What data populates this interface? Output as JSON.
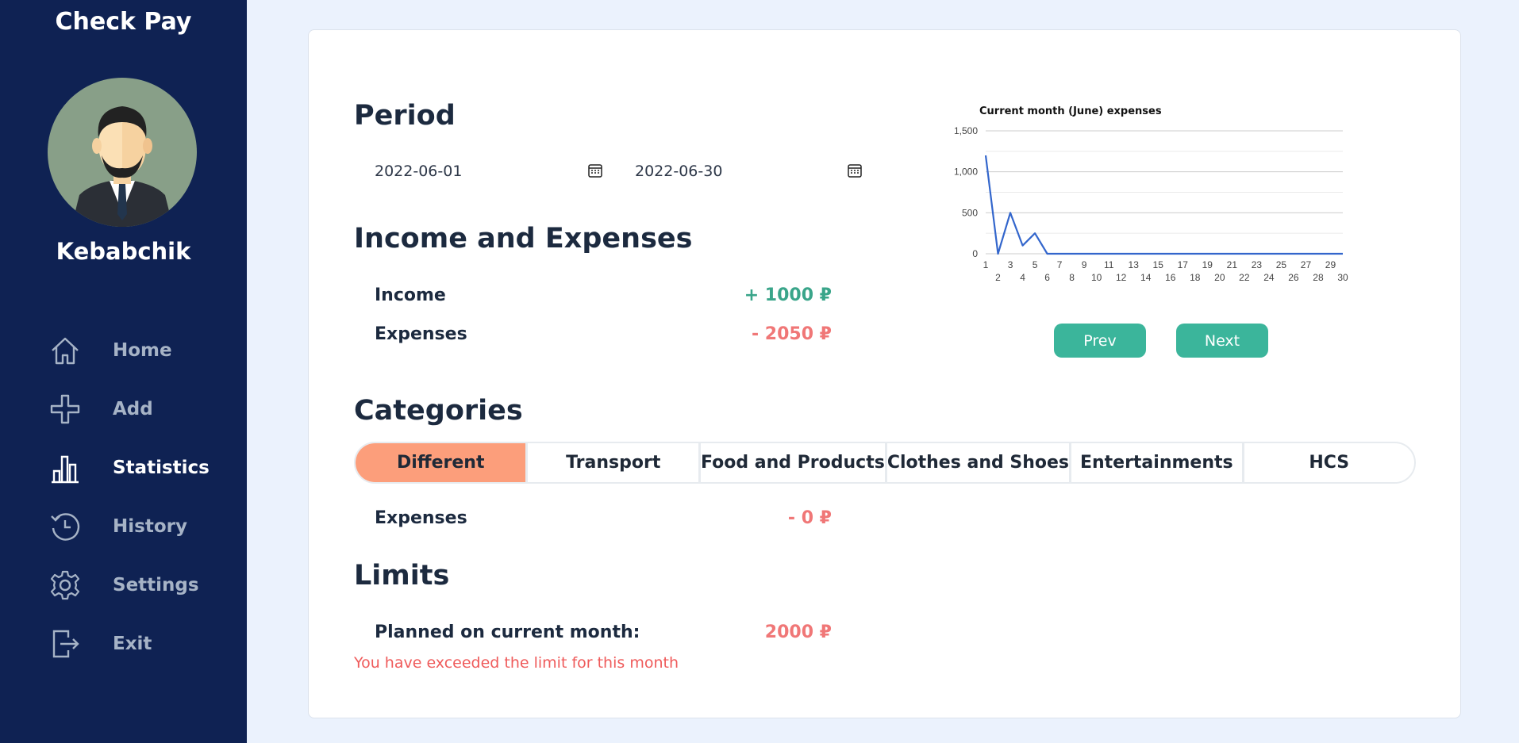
{
  "app": {
    "title": "Check Pay"
  },
  "user": {
    "name": "Kebabchik"
  },
  "nav": [
    {
      "label": "Home",
      "icon": "home-icon"
    },
    {
      "label": "Add",
      "icon": "plus-icon"
    },
    {
      "label": "Statistics",
      "icon": "bar-chart-icon",
      "active": true
    },
    {
      "label": "History",
      "icon": "history-icon"
    },
    {
      "label": "Settings",
      "icon": "gear-icon"
    },
    {
      "label": "Exit",
      "icon": "exit-icon"
    }
  ],
  "period": {
    "heading": "Period",
    "start": "2022-06-01",
    "end": "2022-06-30"
  },
  "income_expenses": {
    "heading": "Income and Expenses",
    "income_label": "Income",
    "income_value": "+ 1000 ₽",
    "expenses_label": "Expenses",
    "expenses_value": "- 2050 ₽"
  },
  "categories": {
    "heading": "Categories",
    "tabs": [
      "Different",
      "Transport",
      "Food and Products",
      "Clothes and Shoes",
      "Entertainments",
      "HCS"
    ],
    "active": "Different",
    "expenses_label": "Expenses",
    "expenses_value": "- 0 ₽"
  },
  "limits": {
    "heading": "Limits",
    "planned_label": "Planned on current month:",
    "planned_value": "2000 ₽",
    "warning": "You have exceeded the limit for this month"
  },
  "buttons": {
    "prev": "Prev",
    "next": "Next"
  },
  "colors": {
    "sidebar": "#0f2253",
    "accent": "#3bb59b",
    "active_tab": "#fc9e7b",
    "positive": "#3aa58a",
    "negative": "#f07777",
    "line": "#3366cc"
  },
  "chart_data": {
    "type": "line",
    "title": "Current month (June) expenses",
    "xlabel": "",
    "ylabel": "",
    "x": [
      1,
      2,
      3,
      4,
      5,
      6,
      7,
      8,
      9,
      10,
      11,
      12,
      13,
      14,
      15,
      16,
      17,
      18,
      19,
      20,
      21,
      22,
      23,
      24,
      25,
      26,
      27,
      28,
      29,
      30
    ],
    "series": [
      {
        "values": [
          1200,
          0,
          500,
          100,
          250,
          0,
          0,
          0,
          0,
          0,
          0,
          0,
          0,
          0,
          0,
          0,
          0,
          0,
          0,
          0,
          0,
          0,
          0,
          0,
          0,
          0,
          0,
          0,
          0,
          0
        ]
      }
    ],
    "yticks": [
      "0",
      "500",
      "1,000",
      "1,500"
    ],
    "ylim": [
      0,
      1500
    ],
    "xlim": [
      1,
      30
    ],
    "grid": true
  }
}
